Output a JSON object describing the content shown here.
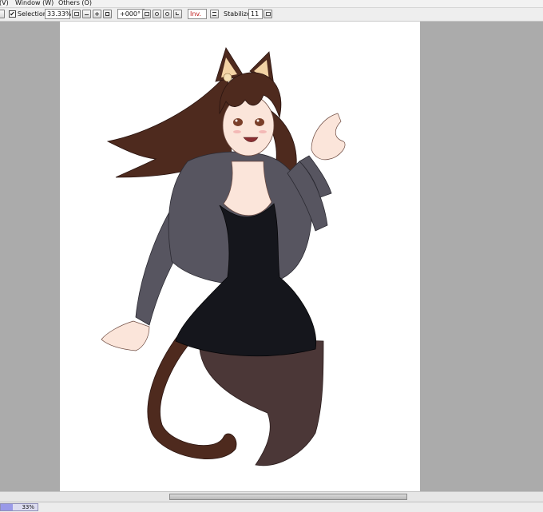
{
  "menu": {
    "items": [
      "(V)",
      "Window (W)",
      "Others (O)"
    ]
  },
  "toolbar": {
    "selection_label": "Selection",
    "selection_checked": true,
    "zoom_value": "33.33%",
    "rotation_value": "+000°",
    "invert_label": "Inv.",
    "stabilizer_label": "Stabilizer",
    "stabilizer_value": "11"
  },
  "status": {
    "zoom_text": "33%",
    "zoom_fraction": 0.33
  },
  "canvas": {
    "description_icons": [
      "cat-girl-illustration"
    ],
    "colors": {
      "hair": "#4e2a1e",
      "jacket": "#575560",
      "dress": "#15161c",
      "tights": "#4b3737",
      "skin": "#fbe5da",
      "paper": "#ffffff",
      "workspace": "#ababab"
    }
  }
}
